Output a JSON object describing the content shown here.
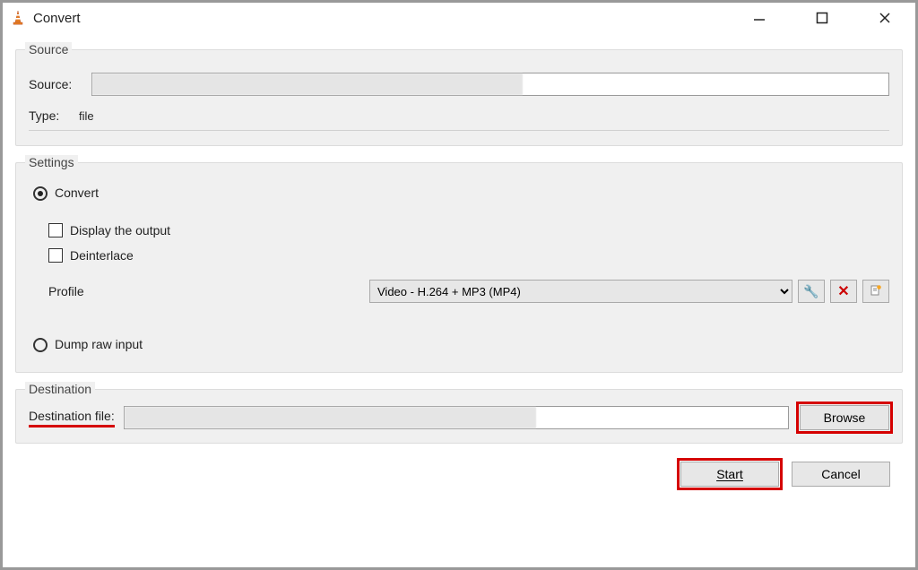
{
  "window": {
    "title": "Convert"
  },
  "source_group": {
    "legend": "Source",
    "source_label": "Source:",
    "source_value": "",
    "type_label": "Type:",
    "type_value": "file"
  },
  "settings_group": {
    "legend": "Settings",
    "convert_label": "Convert",
    "display_output_label": "Display the output",
    "deinterlace_label": "Deinterlace",
    "profile_label": "Profile",
    "profile_selected": "Video - H.264 + MP3 (MP4)",
    "dump_raw_label": "Dump raw input",
    "edit_tooltip": "Edit selected profile",
    "delete_tooltip": "Delete selected profile",
    "new_tooltip": "Create a new profile"
  },
  "destination_group": {
    "legend": "Destination",
    "dest_label": "Destination file:",
    "dest_value": "",
    "browse_label": "Browse"
  },
  "footer": {
    "start_label": "Start",
    "cancel_label": "Cancel"
  }
}
